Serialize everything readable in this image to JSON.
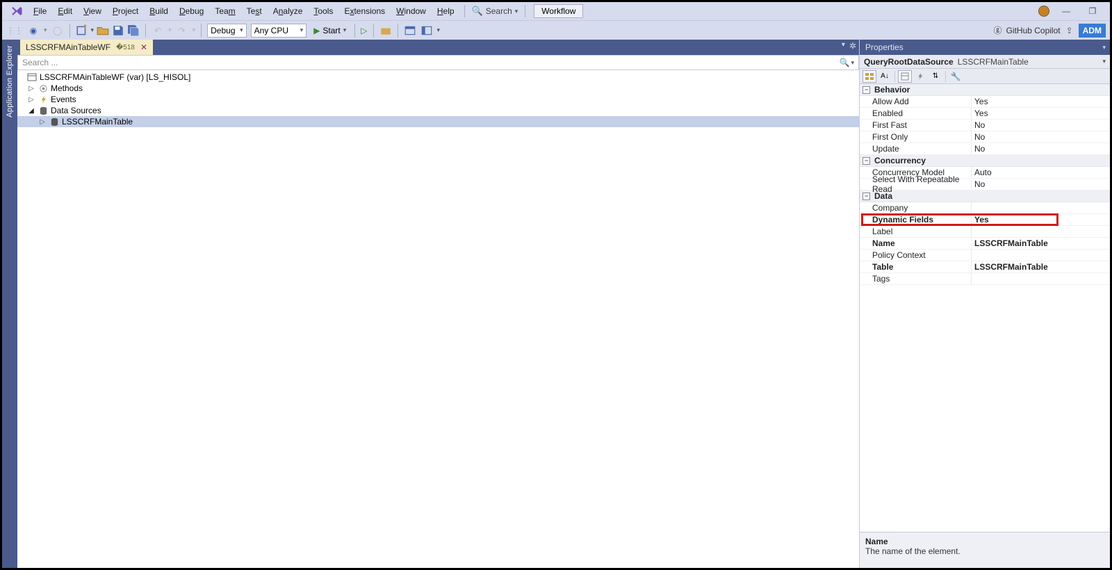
{
  "menu": {
    "items": [
      "File",
      "Edit",
      "View",
      "Project",
      "Build",
      "Debug",
      "Team",
      "Test",
      "Analyze",
      "Tools",
      "Extensions",
      "Window",
      "Help"
    ],
    "search_label": "Search",
    "workflow": "Workflow"
  },
  "toolbar": {
    "config": "Debug",
    "platform": "Any CPU",
    "start": "Start",
    "copilot": "GitHub Copilot",
    "adm": "ADM"
  },
  "left_rail": "Application Explorer",
  "doc": {
    "tab": "LSSCRFMAinTableWF",
    "search_placeholder": "Search ...",
    "tree": {
      "root": "LSSCRFMAinTableWF (var) [LS_HISOL]",
      "methods": "Methods",
      "events": "Events",
      "ds": "Data Sources",
      "ds_item": "LSSCRFMainTable"
    }
  },
  "props": {
    "title": "Properties",
    "sel_type": "QueryRootDataSource",
    "sel_name": "LSSCRFMainTable",
    "categories": {
      "behavior": "Behavior",
      "concurrency": "Concurrency",
      "data": "Data"
    },
    "rows": {
      "allow_add": {
        "n": "Allow Add",
        "v": "Yes"
      },
      "enabled": {
        "n": "Enabled",
        "v": "Yes"
      },
      "first_fast": {
        "n": "First Fast",
        "v": "No"
      },
      "first_only": {
        "n": "First Only",
        "v": "No"
      },
      "update": {
        "n": "Update",
        "v": "No"
      },
      "conc_model": {
        "n": "Concurrency Model",
        "v": "Auto"
      },
      "repeat_read": {
        "n": "Select With Repeatable Read",
        "v": "No"
      },
      "company": {
        "n": "Company",
        "v": ""
      },
      "dyn_fields": {
        "n": "Dynamic Fields",
        "v": "Yes"
      },
      "label": {
        "n": "Label",
        "v": ""
      },
      "name": {
        "n": "Name",
        "v": "LSSCRFMainTable"
      },
      "policy": {
        "n": "Policy Context",
        "v": ""
      },
      "table": {
        "n": "Table",
        "v": "LSSCRFMainTable"
      },
      "tags": {
        "n": "Tags",
        "v": ""
      }
    },
    "help_name": "Name",
    "help_desc": "The name of the element."
  }
}
